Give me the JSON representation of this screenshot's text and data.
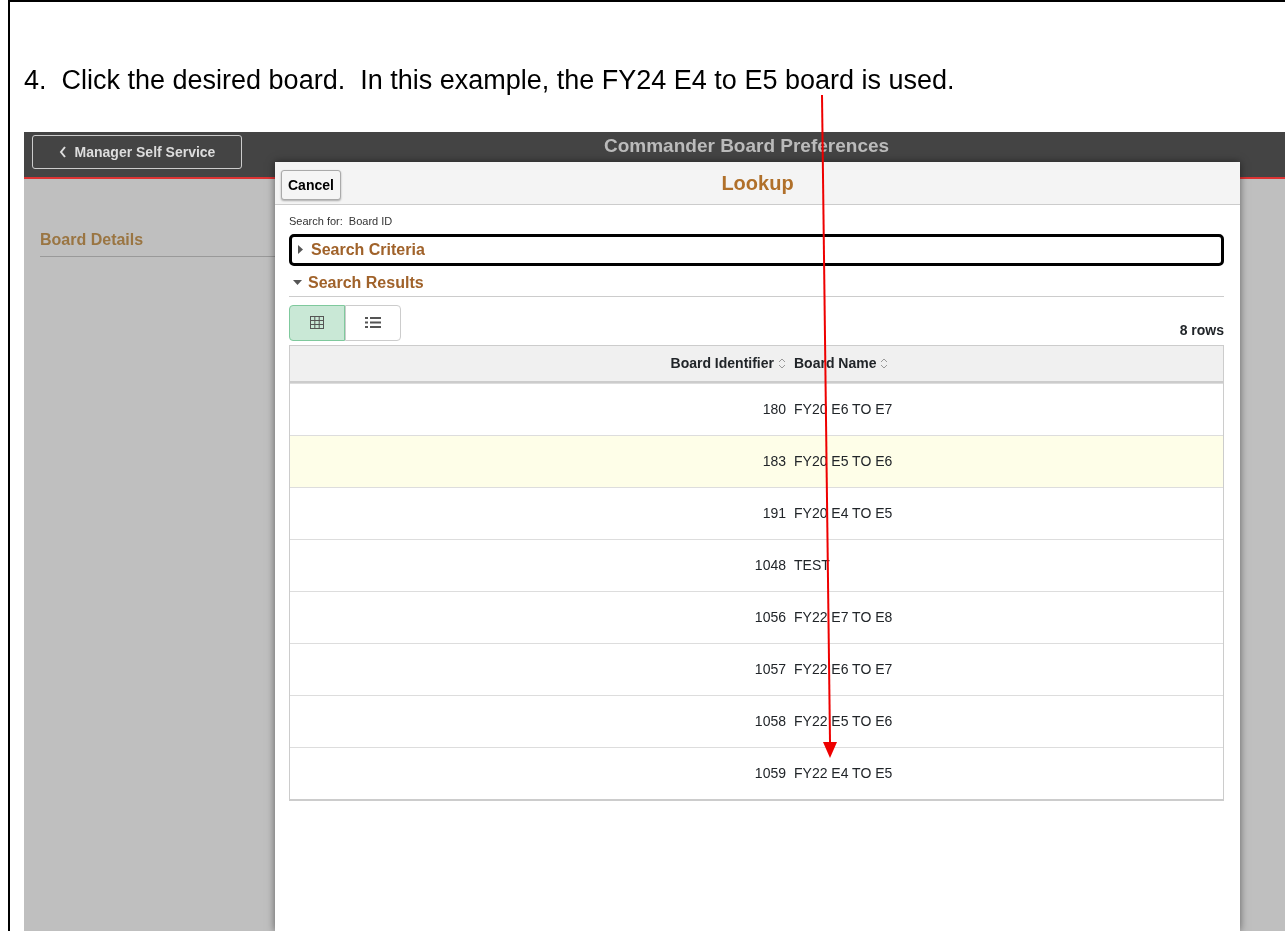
{
  "instruction": "4.  Click the desired board.  In this example, the FY24 E4 to E5 board is used.",
  "page": {
    "back_button": "Manager Self Service",
    "title": "Commander Board Preferences",
    "section": "Board Details"
  },
  "lookup": {
    "cancel_button": "Cancel",
    "title": "Lookup",
    "search_for_label": "Search for:",
    "search_for_value": "Board ID",
    "sections": [
      {
        "label": "Search Criteria",
        "expanded": false
      },
      {
        "label": "Search Results",
        "expanded": true
      }
    ],
    "view_buttons": [
      {
        "kind": "grid",
        "selected": true
      },
      {
        "kind": "list",
        "selected": false
      }
    ],
    "row_count": "8 rows",
    "table": {
      "columns": [
        "Board Identifier",
        "Board Name"
      ],
      "rows": [
        {
          "id": "180",
          "name": "FY20 E6 TO E7",
          "highlighted": false
        },
        {
          "id": "183",
          "name": "FY20 E5 TO E6",
          "highlighted": true
        },
        {
          "id": "191",
          "name": "FY20 E4 TO E5",
          "highlighted": false
        },
        {
          "id": "1048",
          "name": "TEST",
          "highlighted": false
        },
        {
          "id": "1056",
          "name": "FY22 E7 TO E8",
          "highlighted": false
        },
        {
          "id": "1057",
          "name": "FY22 E6 TO E7",
          "highlighted": false
        },
        {
          "id": "1058",
          "name": "FY22 E5 TO E6",
          "highlighted": false
        },
        {
          "id": "1059",
          "name": "FY22 E4 TO E5",
          "highlighted": false
        }
      ]
    }
  }
}
